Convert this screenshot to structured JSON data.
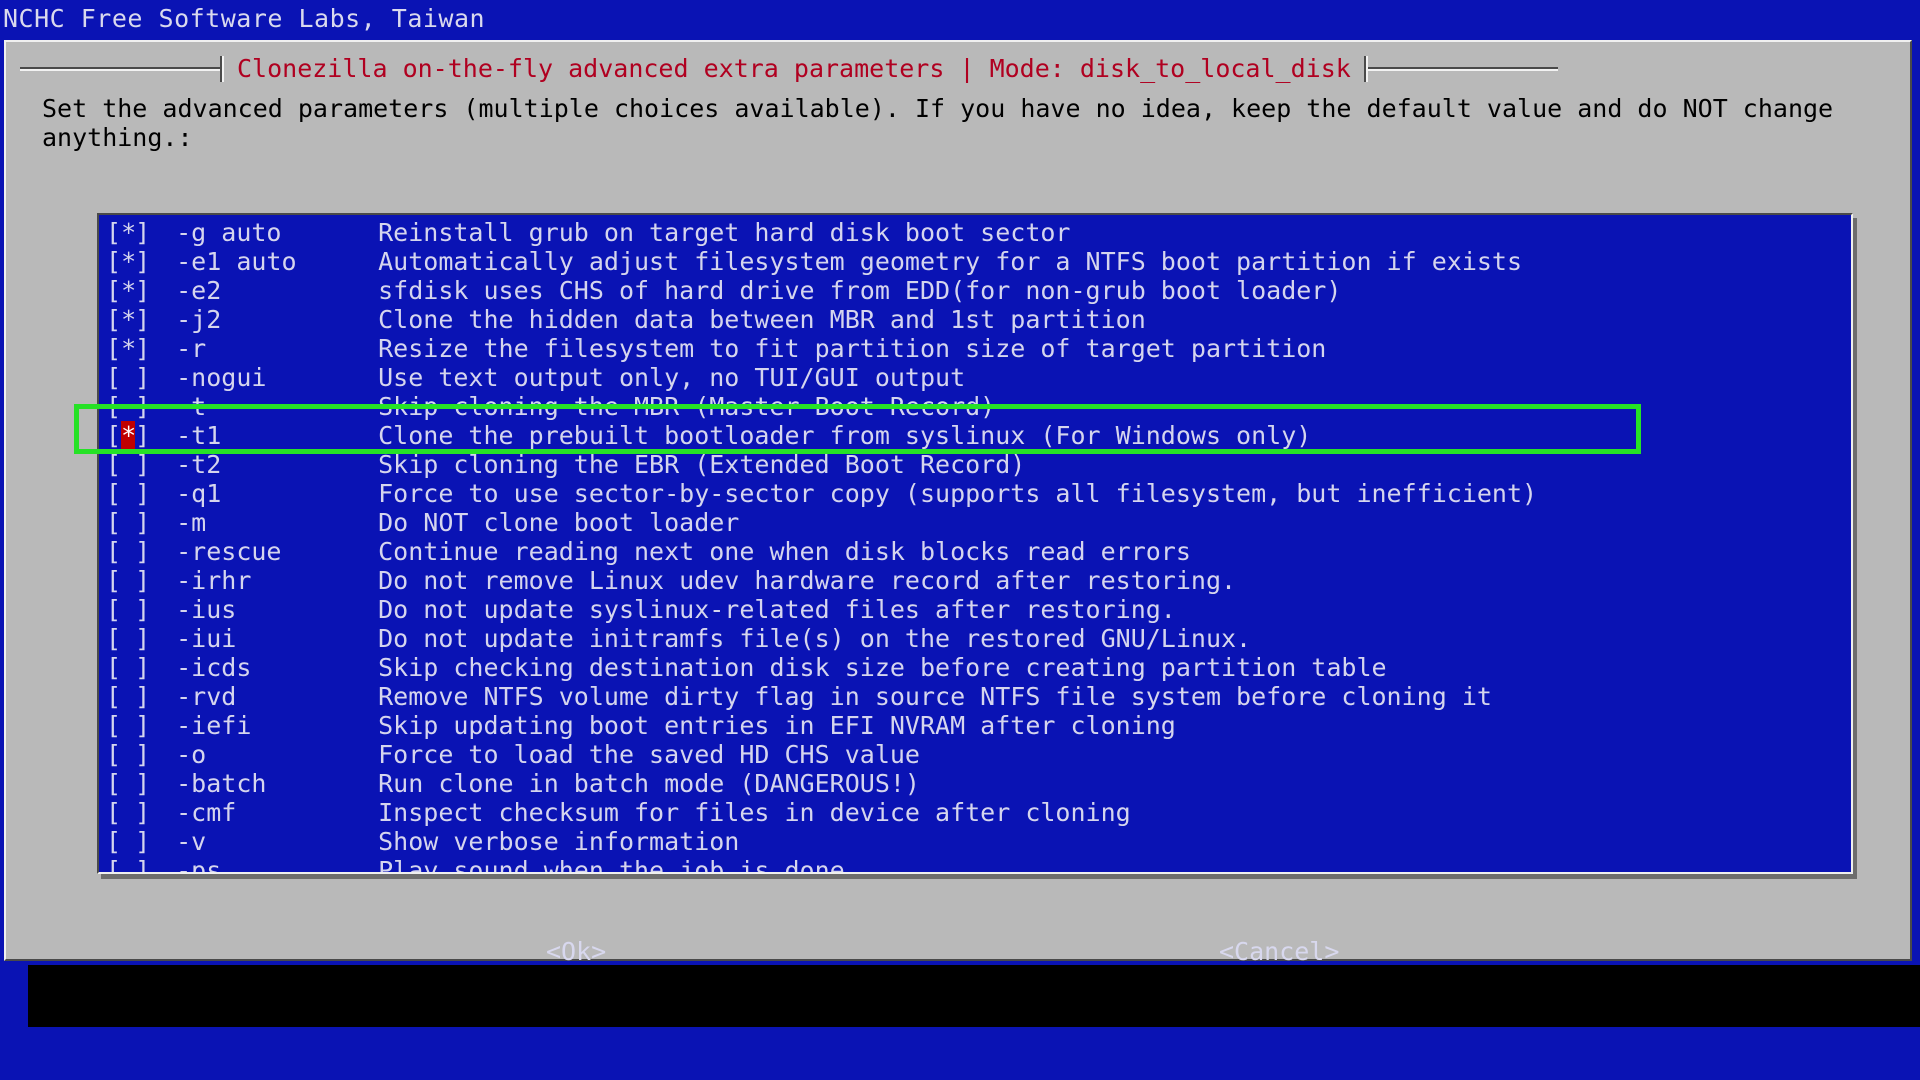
{
  "banner": {
    "text": "NCHC Free Software Labs, Taiwan"
  },
  "dialog": {
    "title": "Clonezilla on-the-fly advanced extra parameters | Mode: disk_to_local_disk",
    "prompt": "Set the advanced parameters (multiple choices available). If you have no idea, keep the default value and do NOT change anything.:",
    "title_color": "#b00020",
    "background_color": "#b9b9b9"
  },
  "list": {
    "background_color": "#0a13b4",
    "text_color": "#d5d5ee",
    "cursor_color": "#c00000",
    "options": [
      {
        "checked": true,
        "mark": "*",
        "flag": "-g auto",
        "desc": "Reinstall grub on target hard disk boot sector",
        "cursor": false
      },
      {
        "checked": true,
        "mark": "*",
        "flag": "-e1 auto",
        "desc": "Automatically adjust filesystem geometry for a NTFS boot partition if exists",
        "cursor": false
      },
      {
        "checked": true,
        "mark": "*",
        "flag": "-e2",
        "desc": "sfdisk uses CHS of hard drive from EDD(for non-grub boot loader)",
        "cursor": false
      },
      {
        "checked": true,
        "mark": "*",
        "flag": "-j2",
        "desc": "Clone the hidden data between MBR and 1st partition",
        "cursor": false
      },
      {
        "checked": true,
        "mark": "*",
        "flag": "-r",
        "desc": "Resize the filesystem to fit partition size of target partition",
        "cursor": false
      },
      {
        "checked": false,
        "mark": " ",
        "flag": "-nogui",
        "desc": "Use text output only, no TUI/GUI output",
        "cursor": false
      },
      {
        "checked": false,
        "mark": " ",
        "flag": "-t",
        "desc": "Skip cloning the MBR (Master Boot Record)",
        "cursor": false
      },
      {
        "checked": true,
        "mark": "*",
        "flag": "-t1",
        "desc": "Clone the prebuilt bootloader from syslinux (For Windows only)",
        "cursor": true
      },
      {
        "checked": false,
        "mark": " ",
        "flag": "-t2",
        "desc": "Skip cloning the EBR (Extended Boot Record)",
        "cursor": false
      },
      {
        "checked": false,
        "mark": " ",
        "flag": "-q1",
        "desc": "Force to use sector-by-sector copy (supports all filesystem, but inefficient)",
        "cursor": false
      },
      {
        "checked": false,
        "mark": " ",
        "flag": "-m",
        "desc": "Do NOT clone boot loader",
        "cursor": false
      },
      {
        "checked": false,
        "mark": " ",
        "flag": "-rescue",
        "desc": "Continue reading next one when disk blocks read errors",
        "cursor": false
      },
      {
        "checked": false,
        "mark": " ",
        "flag": "-irhr",
        "desc": "Do not remove Linux udev hardware record after restoring.",
        "cursor": false
      },
      {
        "checked": false,
        "mark": " ",
        "flag": "-ius",
        "desc": "Do not update syslinux-related files after restoring.",
        "cursor": false
      },
      {
        "checked": false,
        "mark": " ",
        "flag": "-iui",
        "desc": "Do not update initramfs file(s) on the restored GNU/Linux.",
        "cursor": false
      },
      {
        "checked": false,
        "mark": " ",
        "flag": "-icds",
        "desc": "Skip checking destination disk size before creating partition table",
        "cursor": false
      },
      {
        "checked": false,
        "mark": " ",
        "flag": "-rvd",
        "desc": "Remove NTFS volume dirty flag in source NTFS file system before cloning it",
        "cursor": false
      },
      {
        "checked": false,
        "mark": " ",
        "flag": "-iefi",
        "desc": "Skip updating boot entries in EFI NVRAM after cloning",
        "cursor": false
      },
      {
        "checked": false,
        "mark": " ",
        "flag": "-o",
        "desc": "Force to load the saved HD CHS value",
        "cursor": false
      },
      {
        "checked": false,
        "mark": " ",
        "flag": "-batch",
        "desc": "Run clone in batch mode (DANGEROUS!)",
        "cursor": false
      },
      {
        "checked": false,
        "mark": " ",
        "flag": "-cmf",
        "desc": "Inspect checksum for files in device after cloning",
        "cursor": false
      },
      {
        "checked": false,
        "mark": " ",
        "flag": "-v",
        "desc": "Show verbose information",
        "cursor": false
      },
      {
        "checked": false,
        "mark": " ",
        "flag": "-ps",
        "desc": "Play sound when the job is done",
        "cursor": false
      }
    ]
  },
  "buttons": {
    "ok": "<Ok>",
    "cancel": "<Cancel>"
  },
  "annotation": {
    "color": "#26e226",
    "target_flag": "-t1"
  }
}
